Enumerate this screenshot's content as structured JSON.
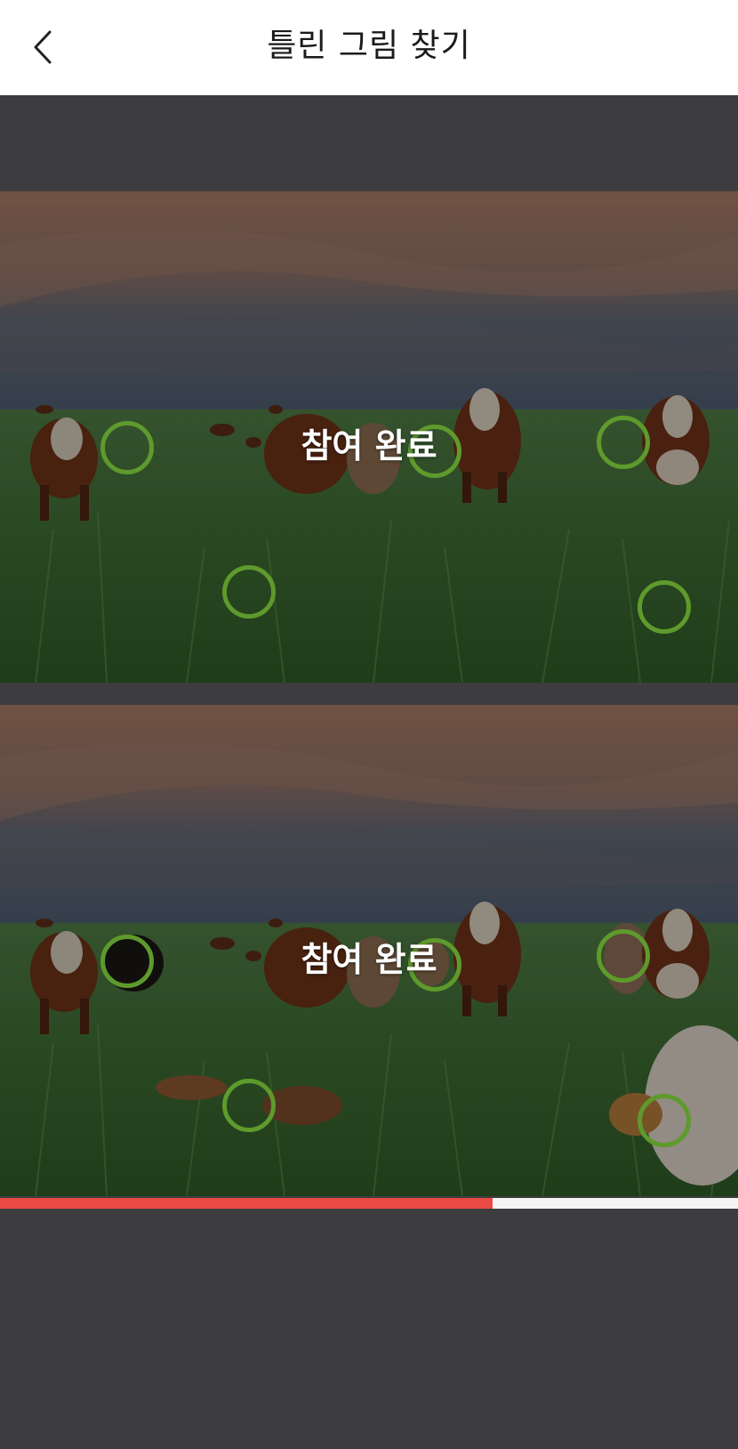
{
  "header": {
    "title": "틀린 그림 찾기",
    "back_icon": "chevron-left-icon"
  },
  "game": {
    "overlay_text": "참여 완료",
    "found_marker_color": "#5e9a2c",
    "images": [
      {
        "name": "original-image"
      },
      {
        "name": "modified-image"
      }
    ]
  },
  "progress": {
    "value": 0.667,
    "fill_color": "#ea4a45",
    "track_color": "#f4f4f4"
  }
}
